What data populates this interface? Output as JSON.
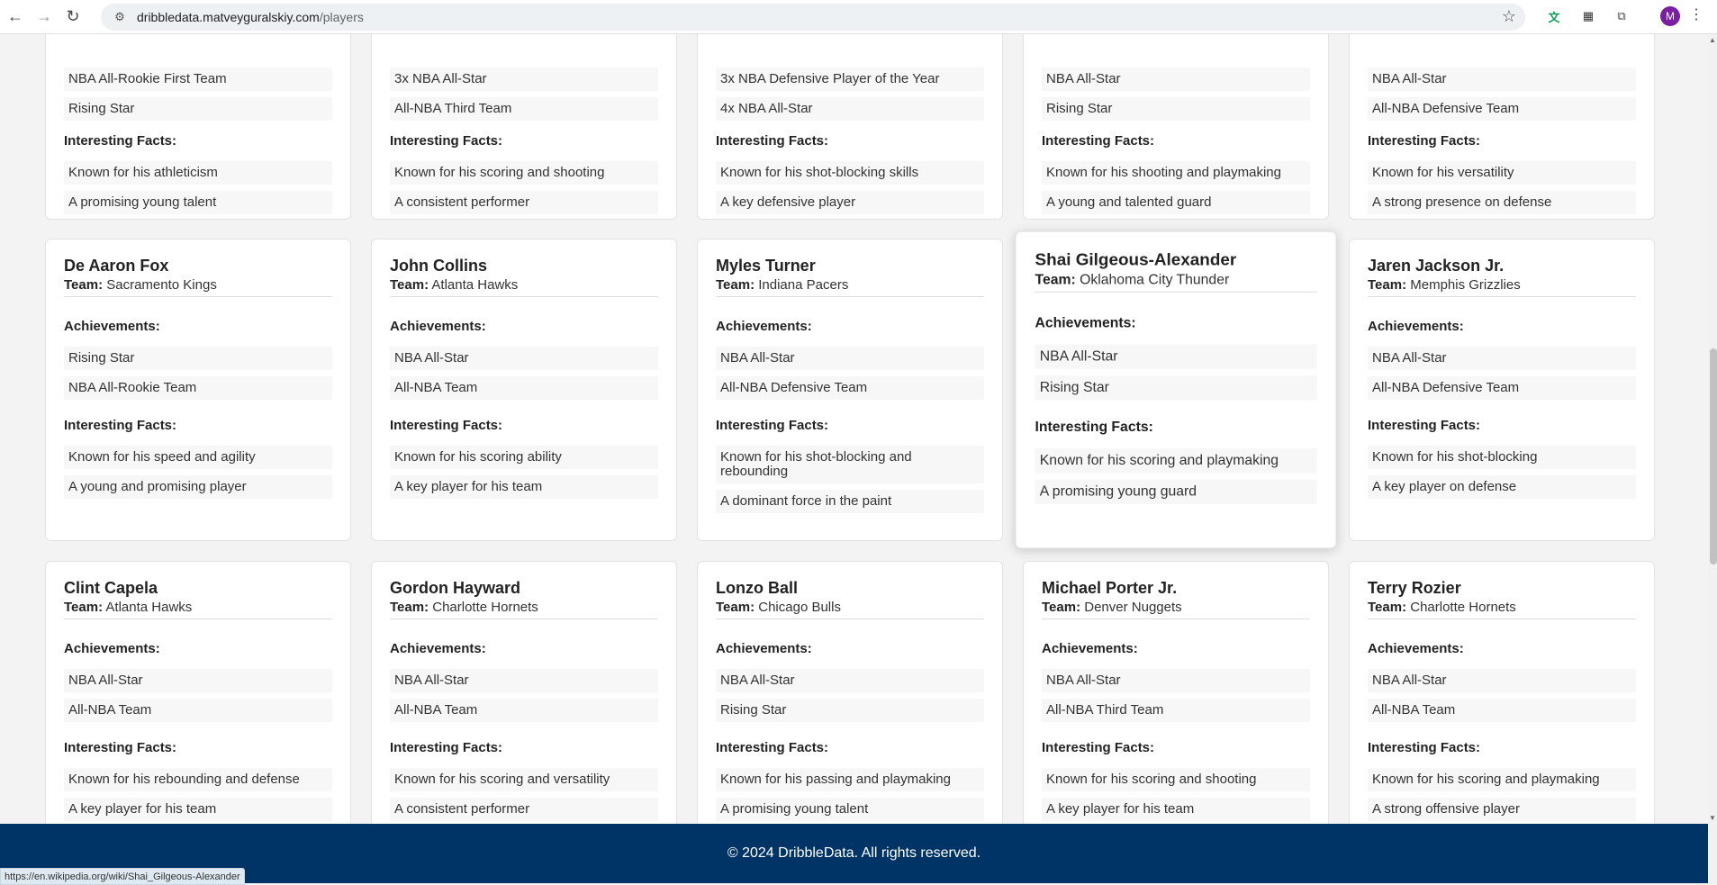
{
  "browser": {
    "url_host": "dribbledata.matveyguralskiy.com",
    "url_path": "/players"
  },
  "row1": [
    {
      "achievements": [
        "NBA All-Rookie First Team",
        "Rising Star"
      ],
      "facts_title": "Interesting Facts:",
      "facts": [
        "Known for his athleticism",
        "A promising young talent"
      ]
    },
    {
      "achievements": [
        "3x NBA All-Star",
        "All-NBA Third Team"
      ],
      "facts_title": "Interesting Facts:",
      "facts": [
        "Known for his scoring and shooting",
        "A consistent performer"
      ]
    },
    {
      "achievements": [
        "3x NBA Defensive Player of the Year",
        "4x NBA All-Star"
      ],
      "facts_title": "Interesting Facts:",
      "facts": [
        "Known for his shot-blocking skills",
        "A key defensive player"
      ]
    },
    {
      "achievements": [
        "NBA All-Star",
        "Rising Star"
      ],
      "facts_title": "Interesting Facts:",
      "facts": [
        "Known for his shooting and playmaking",
        "A young and talented guard"
      ]
    },
    {
      "achievements": [
        "NBA All-Star",
        "All-NBA Defensive Team"
      ],
      "facts_title": "Interesting Facts:",
      "facts": [
        "Known for his versatility",
        "A strong presence on defense"
      ]
    }
  ],
  "row2": [
    {
      "name": "De Aaron Fox",
      "team_label": "Team:",
      "team": "Sacramento Kings",
      "achievements_title": "Achievements:",
      "achievements": [
        "Rising Star",
        "NBA All-Rookie Team"
      ],
      "facts_title": "Interesting Facts:",
      "facts": [
        "Known for his speed and agility",
        "A young and promising player"
      ]
    },
    {
      "name": "John Collins",
      "team_label": "Team:",
      "team": "Atlanta Hawks",
      "achievements_title": "Achievements:",
      "achievements": [
        "NBA All-Star",
        "All-NBA Team"
      ],
      "facts_title": "Interesting Facts:",
      "facts": [
        "Known for his scoring ability",
        "A key player for his team"
      ]
    },
    {
      "name": "Myles Turner",
      "team_label": "Team:",
      "team": "Indiana Pacers",
      "achievements_title": "Achievements:",
      "achievements": [
        "NBA All-Star",
        "All-NBA Defensive Team"
      ],
      "facts_title": "Interesting Facts:",
      "facts": [
        "Known for his shot-blocking and rebounding",
        "A dominant force in the paint"
      ]
    },
    {
      "name": "Shai Gilgeous-Alexander",
      "team_label": "Team:",
      "team": "Oklahoma City Thunder",
      "achievements_title": "Achievements:",
      "achievements": [
        "NBA All-Star",
        "Rising Star"
      ],
      "facts_title": "Interesting Facts:",
      "facts": [
        "Known for his scoring and playmaking",
        "A promising young guard"
      ]
    },
    {
      "name": "Jaren Jackson Jr.",
      "team_label": "Team:",
      "team": "Memphis Grizzlies",
      "achievements_title": "Achievements:",
      "achievements": [
        "NBA All-Star",
        "All-NBA Defensive Team"
      ],
      "facts_title": "Interesting Facts:",
      "facts": [
        "Known for his shot-blocking",
        "A key player on defense"
      ]
    }
  ],
  "row3": [
    {
      "name": "Clint Capela",
      "team_label": "Team:",
      "team": "Atlanta Hawks",
      "achievements_title": "Achievements:",
      "achievements": [
        "NBA All-Star",
        "All-NBA Team"
      ],
      "facts_title": "Interesting Facts:",
      "facts": [
        "Known for his rebounding and defense",
        "A key player for his team"
      ]
    },
    {
      "name": "Gordon Hayward",
      "team_label": "Team:",
      "team": "Charlotte Hornets",
      "achievements_title": "Achievements:",
      "achievements": [
        "NBA All-Star",
        "All-NBA Team"
      ],
      "facts_title": "Interesting Facts:",
      "facts": [
        "Known for his scoring and versatility",
        "A consistent performer"
      ]
    },
    {
      "name": "Lonzo Ball",
      "team_label": "Team:",
      "team": "Chicago Bulls",
      "achievements_title": "Achievements:",
      "achievements": [
        "NBA All-Star",
        "Rising Star"
      ],
      "facts_title": "Interesting Facts:",
      "facts": [
        "Known for his passing and playmaking",
        "A promising young talent"
      ]
    },
    {
      "name": "Michael Porter Jr.",
      "team_label": "Team:",
      "team": "Denver Nuggets",
      "achievements_title": "Achievements:",
      "achievements": [
        "NBA All-Star",
        "All-NBA Third Team"
      ],
      "facts_title": "Interesting Facts:",
      "facts": [
        "Known for his scoring and shooting",
        "A key player for his team"
      ]
    },
    {
      "name": "Terry Rozier",
      "team_label": "Team:",
      "team": "Charlotte Hornets",
      "achievements_title": "Achievements:",
      "achievements": [
        "NBA All-Star",
        "All-NBA Team"
      ],
      "facts_title": "Interesting Facts:",
      "facts": [
        "Known for his scoring and playmaking",
        "A strong offensive player"
      ]
    }
  ],
  "footer": {
    "text": "© 2024 DribbleData. All rights reserved."
  },
  "status_bar": {
    "link": "https://en.wikipedia.org/wiki/Shai_Gilgeous-Alexander"
  },
  "icons": {
    "back": "arrow-left-icon",
    "forward": "arrow-right-icon",
    "reload": "reload-icon",
    "site_info": "tune-icon",
    "bookmark": "star-icon",
    "extension_1": "translate-icon",
    "extension_2": "qr-code-icon",
    "extensions": "puzzle-icon",
    "profile": "avatar",
    "menu": "kebab-menu-icon"
  },
  "profile_initial": "M"
}
